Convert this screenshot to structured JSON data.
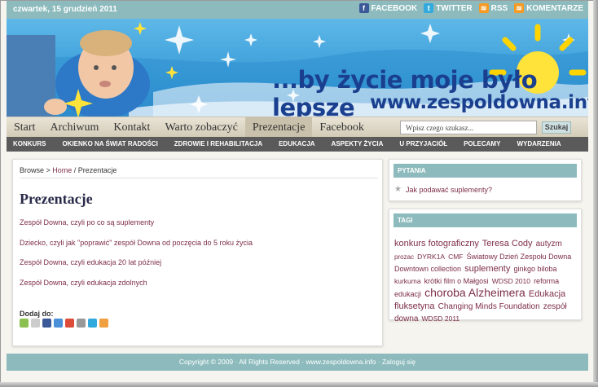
{
  "topbar": {
    "date": "czwartek, 15 grudzień 2011",
    "social": [
      {
        "label": "FACEBOOK",
        "icon": "facebook-icon",
        "glyph": "f"
      },
      {
        "label": "TWITTER",
        "icon": "twitter-icon",
        "glyph": "t"
      },
      {
        "label": "RSS",
        "icon": "rss-icon",
        "glyph": "≋"
      },
      {
        "label": "KOMENTARZE",
        "icon": "rss-icon",
        "glyph": "≋"
      }
    ]
  },
  "banner": {
    "tagline": "...by życie moje było lepsze",
    "site": "www.zespoldowna.info"
  },
  "mainnav": {
    "links": [
      "Start",
      "Archiwum",
      "Kontakt",
      "Warto zobaczyć",
      "Prezentacje",
      "Facebook"
    ],
    "active": "Prezentacje",
    "search_placeholder": "Wpisz czego szukasz...",
    "search_button": "Szukaj"
  },
  "catnav": [
    "KONKURS",
    "OKIENKO NA ŚWIAT RADOŚCI",
    "ZDROWIE I REHABILITACJA",
    "EDUKACJA",
    "ASPEKTY ŻYCIA",
    "U PRZYJACIÓŁ",
    "POLECAMY",
    "WYDARZENIA"
  ],
  "content": {
    "breadcrumb": {
      "browse": "Browse > ",
      "home": "Home",
      "current": " / Prezentacje"
    },
    "title": "Prezentacje",
    "links": [
      "Zespół Downa, czyli po co są suplementy",
      "Dziecko, czyli jak \"poprawić\" zespół Downa od poczęcia do 5 roku życia",
      "Zespół Downa, czyli edukacja 20 lat później",
      "Zespół Downa, czyli edukacja zdolnych"
    ],
    "share_label": "Dodaj do:",
    "share_colors": [
      "#8cc152",
      "#cccccc",
      "#3b5998",
      "#4a90d9",
      "#dd4b39",
      "#999999",
      "#33aadd",
      "#f0a040"
    ]
  },
  "sidebar": {
    "pytania": {
      "title": "PYTANIA",
      "question": "Jak podawać suplementy?"
    },
    "tagi": {
      "title": "TAGI",
      "tags": [
        {
          "t": "konkurs fotograficzny",
          "s": 11
        },
        {
          "t": "Teresa Cody",
          "s": 11
        },
        {
          "t": "autyzm",
          "s": 10
        },
        {
          "t": "prozac",
          "s": 8
        },
        {
          "t": "DYRK1A",
          "s": 8.5
        },
        {
          "t": "CMF",
          "s": 8.5
        },
        {
          "t": "Światowy Dzień Zespołu Downa",
          "s": 9
        },
        {
          "t": "Downtown collection",
          "s": 9
        },
        {
          "t": "suplementy",
          "s": 11
        },
        {
          "t": "ginkgo biloba",
          "s": 9
        },
        {
          "t": "kurkuma",
          "s": 8.5
        },
        {
          "t": "krótki film o Małgosi",
          "s": 9
        },
        {
          "t": "WDSD 2010",
          "s": 8.5
        },
        {
          "t": "reforma edukacji",
          "s": 9
        },
        {
          "t": "choroba Alzheimera",
          "s": 14
        },
        {
          "t": "Edukacja",
          "s": 11
        },
        {
          "t": "fluksetyna",
          "s": 11
        },
        {
          "t": "Changing Minds Foundation",
          "s": 10
        },
        {
          "t": "zespół downa",
          "s": 10
        },
        {
          "t": "WDSD 2011",
          "s": 8.5
        }
      ]
    }
  },
  "footer": "Copyright © 2009 · All Rights Reserved · www.zespoldowna.info · Zaloguj się"
}
